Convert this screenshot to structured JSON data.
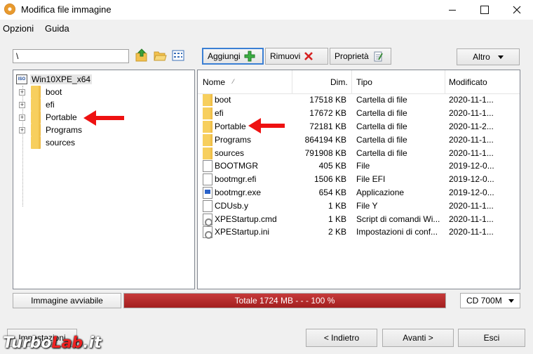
{
  "window": {
    "title": "Modifica file immagine"
  },
  "menu": [
    {
      "label": "Opzioni"
    },
    {
      "label": "Guida"
    }
  ],
  "toolbar": {
    "path_value": "\\",
    "add_label": "Aggiungi",
    "remove_label": "Rimuovi",
    "properties_label": "Proprietà",
    "more_label": "Altro"
  },
  "tree": {
    "root": "Win10XPE_x64",
    "root_icon_text": "ISO",
    "items": [
      {
        "label": "boot",
        "expandable": true
      },
      {
        "label": "efi",
        "expandable": true
      },
      {
        "label": "Portable",
        "expandable": true
      },
      {
        "label": "Programs",
        "expandable": true
      },
      {
        "label": "sources",
        "expandable": false
      }
    ]
  },
  "list": {
    "columns": {
      "name": "Nome",
      "size": "Dim.",
      "type": "Tipo",
      "modified": "Modificato"
    },
    "rows": [
      {
        "icon": "folder-icon",
        "name": "boot",
        "size": "17518 KB",
        "type": "Cartella di file",
        "modified": "2020-11-1..."
      },
      {
        "icon": "folder-icon",
        "name": "efi",
        "size": "17672 KB",
        "type": "Cartella di file",
        "modified": "2020-11-1..."
      },
      {
        "icon": "folder-icon",
        "name": "Portable",
        "size": "72181 KB",
        "type": "Cartella di file",
        "modified": "2020-11-2..."
      },
      {
        "icon": "folder-icon",
        "name": "Programs",
        "size": "864194 KB",
        "type": "Cartella di file",
        "modified": "2020-11-1..."
      },
      {
        "icon": "folder-icon",
        "name": "sources",
        "size": "791908 KB",
        "type": "Cartella di file",
        "modified": "2020-11-1..."
      },
      {
        "icon": "file-icon",
        "name": "BOOTMGR",
        "size": "405 KB",
        "type": "File",
        "modified": "2019-12-0..."
      },
      {
        "icon": "file-icon",
        "name": "bootmgr.efi",
        "size": "1506 KB",
        "type": "File EFI",
        "modified": "2019-12-0..."
      },
      {
        "icon": "exe-icon",
        "name": "bootmgr.exe",
        "size": "654 KB",
        "type": "Applicazione",
        "modified": "2019-12-0..."
      },
      {
        "icon": "file-icon",
        "name": "CDUsb.y",
        "size": "1 KB",
        "type": "File Y",
        "modified": "2020-11-1..."
      },
      {
        "icon": "settings-file-icon",
        "name": "XPEStartup.cmd",
        "size": "1 KB",
        "type": "Script di comandi Wi...",
        "modified": "2020-11-1..."
      },
      {
        "icon": "settings-file-icon",
        "name": "XPEStartup.ini",
        "size": "2 KB",
        "type": "Impostazioni di conf...",
        "modified": "2020-11-1..."
      }
    ]
  },
  "status": {
    "bootable_label": "Immagine avviabile",
    "progress_text": "Totale 1724 MB  - - -  100 %",
    "progress_fraction": 1.0,
    "media_value": "CD 700M"
  },
  "footer": {
    "left_label": "Impostazioni",
    "back_label": "< Indietro",
    "next_label": "Avanti >",
    "exit_label": "Esci"
  },
  "watermark": {
    "part1": "Turbo",
    "part2": "Lab",
    "part3": ".it"
  },
  "colors": {
    "accent": "#3b7fd4",
    "progress": "#b52a2a",
    "annotation_arrow": "#ee1111",
    "folder": "#f7cf5e"
  }
}
